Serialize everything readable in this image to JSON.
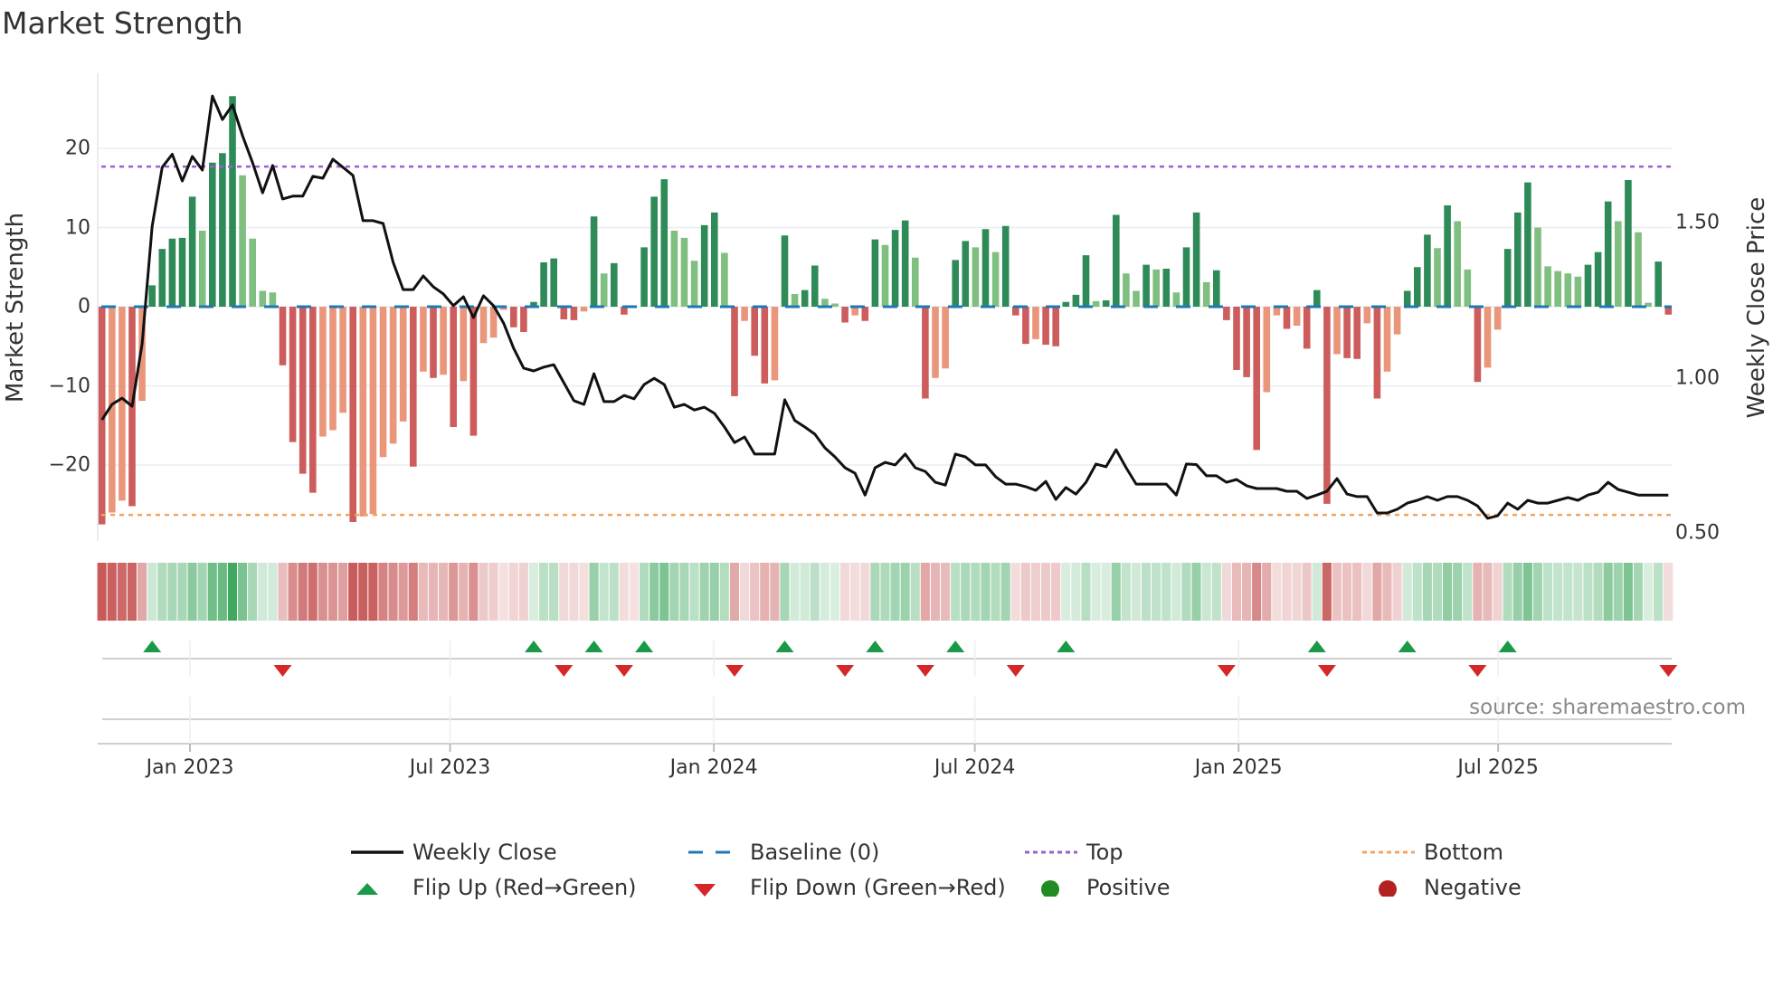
{
  "title": "Market Strength",
  "colors": {
    "strong_green": "#2e8b57",
    "weak_green": "#7fbf7f",
    "strong_red": "#cd5c5c",
    "weak_red": "#e9967a",
    "heat_green": "#3aa55a",
    "heat_red": "#c85a5a",
    "line": "#111111",
    "baseline": "#1f77b4",
    "top": "#9b5fd6",
    "bottom": "#f4a460",
    "flip_up": "#1a9a46",
    "flip_down": "#d62728",
    "positive": "#228b22",
    "negative": "#b22222",
    "grid": "#e9edf3",
    "source": "#8a8a8a"
  },
  "chart_data": {
    "type": "bar",
    "title": "Market Strength",
    "ylabel": "Market Strength",
    "y2label": "Weekly Close Price",
    "ylim": [
      -29.5,
      30
    ],
    "y2lim": [
      0.47,
      2.01
    ],
    "yticks": [
      {
        "v": 20,
        "label": "20"
      },
      {
        "v": 10,
        "label": "10"
      },
      {
        "v": 0,
        "label": "0"
      },
      {
        "v": -10,
        "label": "−10"
      },
      {
        "v": -20,
        "label": "−20"
      }
    ],
    "y2ticks": [
      {
        "v": 1.5,
        "label": "1.50"
      },
      {
        "v": 1.0,
        "label": "1.00"
      },
      {
        "v": 0.5,
        "label": "0.50"
      }
    ],
    "xticks": [
      {
        "week": 8.77,
        "label": "Jan 2023"
      },
      {
        "week": 34.67,
        "label": "Jul 2023"
      },
      {
        "week": 60.94,
        "label": "Jan 2024"
      },
      {
        "week": 86.93,
        "label": "Jul 2024"
      },
      {
        "week": 113.2,
        "label": "Jan 2025"
      },
      {
        "week": 139.05,
        "label": "Jul 2025"
      }
    ],
    "top_level": 17.7,
    "bottom_level": -26.3,
    "baseline": 0,
    "strength": [
      -27.5,
      -26,
      -24.5,
      -25.2,
      -11.9,
      2.7,
      7.3,
      8.6,
      8.7,
      13.9,
      9.6,
      18.2,
      19.4,
      26.6,
      16.6,
      8.6,
      2.0,
      1.8,
      -7.4,
      -17.1,
      -21.1,
      -23.5,
      -16.4,
      -15.6,
      -13.4,
      -27.2,
      -26.5,
      -26.2,
      -19.0,
      -17.3,
      -14.5,
      -20.2,
      -8.2,
      -9.0,
      -8.6,
      -15.2,
      -9.4,
      -16.3,
      -4.6,
      -3.9,
      -0.4,
      -2.6,
      -3.2,
      0.6,
      5.6,
      6.1,
      -1.6,
      -1.7,
      -0.6,
      11.4,
      4.2,
      5.5,
      -1.0,
      0,
      7.5,
      13.9,
      16.1,
      9.6,
      8.7,
      5.8,
      10.3,
      11.9,
      6.8,
      -11.3,
      -1.8,
      -6.2,
      -9.7,
      -9.3,
      9.0,
      1.6,
      2.1,
      5.2,
      1.0,
      0.4,
      -2.0,
      -1.1,
      -1.8,
      8.5,
      7.8,
      9.7,
      10.9,
      6.2,
      -11.6,
      -9.0,
      -7.8,
      5.9,
      8.3,
      7.5,
      9.8,
      6.9,
      10.2,
      -1.1,
      -4.7,
      -4.1,
      -4.8,
      -5.0,
      0.6,
      1.5,
      6.5,
      0.7,
      0.8,
      11.6,
      4.2,
      2.0,
      5.3,
      4.7,
      4.8,
      1.8,
      7.5,
      11.9,
      3.1,
      4.6,
      -1.7,
      -8.0,
      -8.9,
      -18.1,
      -10.8,
      -1.1,
      -2.8,
      -2.4,
      -5.3,
      2.1,
      -24.9,
      -6.0,
      -6.5,
      -6.6,
      -2.1,
      -11.6,
      -8.2,
      -3.5,
      2.0,
      5.0,
      9.1,
      7.4,
      12.8,
      10.8,
      4.7,
      -9.5,
      -7.7,
      -2.9,
      7.3,
      11.9,
      15.7,
      10.0,
      5.1,
      4.5,
      4.2,
      3.8,
      5.3,
      6.9,
      13.3,
      10.8,
      16.0,
      9.4,
      0.5,
      5.7,
      -1.0
    ],
    "weekly_close": [
      0.864,
      0.914,
      0.934,
      0.908,
      1.109,
      1.488,
      1.678,
      1.72,
      1.634,
      1.713,
      1.669,
      1.908,
      1.832,
      1.879,
      1.78,
      1.693,
      1.596,
      1.684,
      1.576,
      1.585,
      1.585,
      1.649,
      1.643,
      1.704,
      1.678,
      1.652,
      1.506,
      1.506,
      1.497,
      1.372,
      1.284,
      1.284,
      1.328,
      1.293,
      1.27,
      1.232,
      1.261,
      1.194,
      1.264,
      1.232,
      1.176,
      1.095,
      1.031,
      1.022,
      1.034,
      1.042,
      0.984,
      0.926,
      0.914,
      1.013,
      0.923,
      0.923,
      0.943,
      0.932,
      0.978,
      0.998,
      0.978,
      0.905,
      0.914,
      0.896,
      0.905,
      0.885,
      0.841,
      0.791,
      0.809,
      0.754,
      0.754,
      0.754,
      0.929,
      0.862,
      0.841,
      0.818,
      0.774,
      0.745,
      0.71,
      0.692,
      0.622,
      0.71,
      0.727,
      0.719,
      0.754,
      0.71,
      0.698,
      0.663,
      0.654,
      0.754,
      0.745,
      0.719,
      0.719,
      0.681,
      0.657,
      0.657,
      0.649,
      0.637,
      0.666,
      0.608,
      0.646,
      0.625,
      0.663,
      0.722,
      0.713,
      0.768,
      0.71,
      0.657,
      0.657,
      0.657,
      0.657,
      0.622,
      0.722,
      0.72,
      0.684,
      0.684,
      0.663,
      0.672,
      0.652,
      0.643,
      0.643,
      0.643,
      0.634,
      0.634,
      0.611,
      0.622,
      0.634,
      0.675,
      0.625,
      0.617,
      0.617,
      0.564,
      0.564,
      0.576,
      0.596,
      0.605,
      0.617,
      0.605,
      0.617,
      0.617,
      0.605,
      0.587,
      0.547,
      0.555,
      0.596,
      0.576,
      0.605,
      0.596,
      0.596,
      0.605,
      0.614,
      0.605,
      0.622,
      0.631,
      0.663,
      0.64,
      0.631,
      0.622,
      0.622,
      0.622,
      0.622
    ],
    "legend": [
      {
        "key": "close",
        "label": "Weekly Close"
      },
      {
        "key": "baseline",
        "label": "Baseline (0)"
      },
      {
        "key": "top",
        "label": "Top"
      },
      {
        "key": "bottom",
        "label": "Bottom"
      },
      {
        "key": "flip_up",
        "label": "Flip Up (Red→Green)"
      },
      {
        "key": "flip_down",
        "label": "Flip Down (Green→Red)"
      },
      {
        "key": "positive",
        "label": "Positive"
      },
      {
        "key": "negative",
        "label": "Negative"
      }
    ],
    "legend_placement": "bottom"
  },
  "source": "source: sharemaestro.com"
}
